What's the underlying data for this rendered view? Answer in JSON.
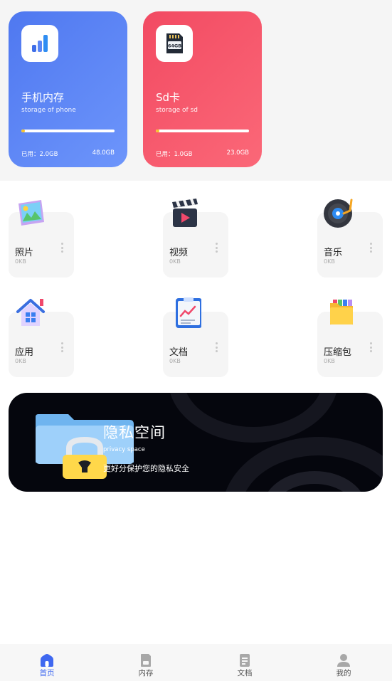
{
  "storage_cards": [
    {
      "title": "手机内存",
      "subtitle": "storage of phone",
      "used": "已用：2.0GB",
      "total": "48.0GB",
      "used_fraction": 0.04,
      "icon": "signal-bars-icon"
    },
    {
      "title": "Sd卡",
      "subtitle": "storage of sd",
      "used": "已用：1.0GB",
      "total": "23.0GB",
      "used_fraction": 0.04,
      "icon": "sd-card-icon",
      "card_label": "64GB"
    }
  ],
  "categories": [
    {
      "label": "照片",
      "size": "0KB",
      "icon": "photo-icon"
    },
    {
      "label": "视频",
      "size": "0KB",
      "icon": "clapperboard-icon"
    },
    {
      "label": "音乐",
      "size": "0KB",
      "icon": "vinyl-record-icon"
    },
    {
      "label": "应用",
      "size": "0KB",
      "icon": "house-icon"
    },
    {
      "label": "文档",
      "size": "0KB",
      "icon": "clipboard-chart-icon"
    },
    {
      "label": "压缩包",
      "size": "0KB",
      "icon": "folder-icon"
    }
  ],
  "privacy": {
    "title": "隐私空间",
    "subtitle": "privacy space",
    "description": "更好分保护您的隐私安全",
    "icon": "locked-folder-icon"
  },
  "nav": [
    {
      "label": "首页",
      "icon": "home-icon",
      "active": true
    },
    {
      "label": "内存",
      "icon": "sd-card-icon",
      "active": false
    },
    {
      "label": "文档",
      "icon": "document-icon",
      "active": false
    },
    {
      "label": "我的",
      "icon": "user-icon",
      "active": false
    }
  ],
  "colors": {
    "phone_card": "#5a83f5",
    "sd_card": "#f55468",
    "progress_fill": "#f7c32e",
    "nav_active": "#3f68f0",
    "banner_bg": "#05060d"
  }
}
